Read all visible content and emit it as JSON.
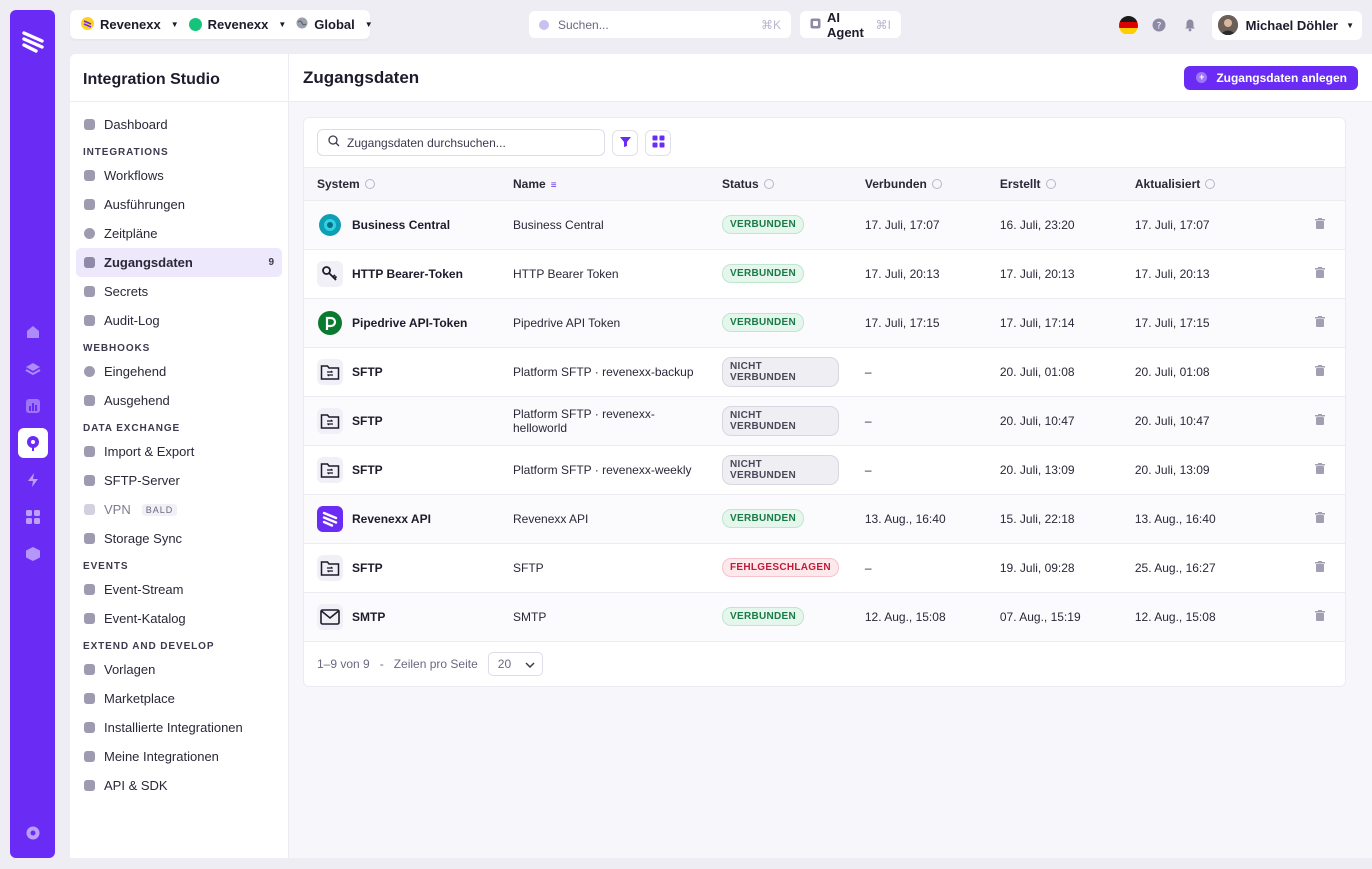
{
  "topbar": {
    "org": "Revenexx",
    "env": "Revenexx",
    "scope": "Global",
    "search_placeholder": "Suchen...",
    "search_shortcut": "⌘K",
    "agent_label": "AI Agent",
    "agent_shortcut": "⌘I",
    "user_name": "Michael Döhler"
  },
  "subnav": {
    "title": "Integration Studio",
    "dashboard": "Dashboard",
    "sections": {
      "integrations": "INTEGRATIONS",
      "webhooks": "WEBHOOKS",
      "data_exchange": "DATA EXCHANGE",
      "events": "EVENTS",
      "extend": "EXTEND AND DEVELOP"
    },
    "items": {
      "workflows": "Workflows",
      "ausfuehrungen": "Ausführungen",
      "zeitplaene": "Zeitpläne",
      "zugangsdaten": "Zugangsdaten",
      "zugangsdaten_count": "9",
      "secrets": "Secrets",
      "audit_log": "Audit-Log",
      "eingehend": "Eingehend",
      "ausgehend": "Ausgehend",
      "import_export": "Import & Export",
      "sftp_server": "SFTP-Server",
      "vpn": "VPN",
      "vpn_tag": "BALD",
      "storage_sync": "Storage Sync",
      "event_stream": "Event-Stream",
      "event_katalog": "Event-Katalog",
      "vorlagen": "Vorlagen",
      "marketplace": "Marketplace",
      "installierte": "Installierte Integrationen",
      "meine": "Meine Integrationen",
      "api_sdk": "API & SDK"
    }
  },
  "main": {
    "title": "Zugangsdaten",
    "create_label": "Zugangsdaten anlegen",
    "table_search_placeholder": "Zugangsdaten durchsuchen...",
    "columns": {
      "system": "System",
      "name": "Name",
      "status": "Status",
      "verbunden": "Verbunden",
      "erstellt": "Erstellt",
      "aktualisiert": "Aktualisiert"
    },
    "rows": [
      {
        "system": "Business Central",
        "name": "Business Central",
        "status": "VERBUNDEN",
        "verbunden": "17. Juli, 17:07",
        "erstellt": "16. Juli, 23:20",
        "aktualisiert": "17. Juli, 17:07"
      },
      {
        "system": "HTTP Bearer-Token",
        "name": "HTTP Bearer Token",
        "status": "VERBUNDEN",
        "verbunden": "17. Juli, 20:13",
        "erstellt": "17. Juli, 20:13",
        "aktualisiert": "17. Juli, 20:13"
      },
      {
        "system": "Pipedrive API-Token",
        "name": "Pipedrive API Token",
        "status": "VERBUNDEN",
        "verbunden": "17. Juli, 17:15",
        "erstellt": "17. Juli, 17:14",
        "aktualisiert": "17. Juli, 17:15"
      },
      {
        "system": "SFTP",
        "name": "Platform SFTP · revenexx-backup",
        "status": "NICHT VERBUNDEN",
        "verbunden": "–",
        "erstellt": "20. Juli, 01:08",
        "aktualisiert": "20. Juli, 01:08"
      },
      {
        "system": "SFTP",
        "name": "Platform SFTP · revenexx-helloworld",
        "status": "NICHT VERBUNDEN",
        "verbunden": "–",
        "erstellt": "20. Juli, 10:47",
        "aktualisiert": "20. Juli, 10:47"
      },
      {
        "system": "SFTP",
        "name": "Platform SFTP · revenexx-weekly",
        "status": "NICHT VERBUNDEN",
        "verbunden": "–",
        "erstellt": "20. Juli, 13:09",
        "aktualisiert": "20. Juli, 13:09"
      },
      {
        "system": "Revenexx API",
        "name": "Revenexx API",
        "status": "VERBUNDEN",
        "verbunden": "13. Aug., 16:40",
        "erstellt": "15. Juli, 22:18",
        "aktualisiert": "13. Aug., 16:40"
      },
      {
        "system": "SFTP",
        "name": "SFTP",
        "status": "FEHLGESCHLAGEN",
        "verbunden": "–",
        "erstellt": "19. Juli, 09:28",
        "aktualisiert": "25. Aug., 16:27"
      },
      {
        "system": "SMTP",
        "name": "SMTP",
        "status": "VERBUNDEN",
        "verbunden": "12. Aug., 15:08",
        "erstellt": "07. Aug., 15:19",
        "aktualisiert": "12. Aug., 15:08"
      }
    ],
    "pager": {
      "range": "1–9 von 9",
      "sep": "-",
      "rows_label": "Zeilen pro Seite",
      "rows_value": "20"
    }
  },
  "colors": {
    "accent": "#6a2cf5",
    "ok": "#1a7a47",
    "fail": "#c01c3a"
  }
}
